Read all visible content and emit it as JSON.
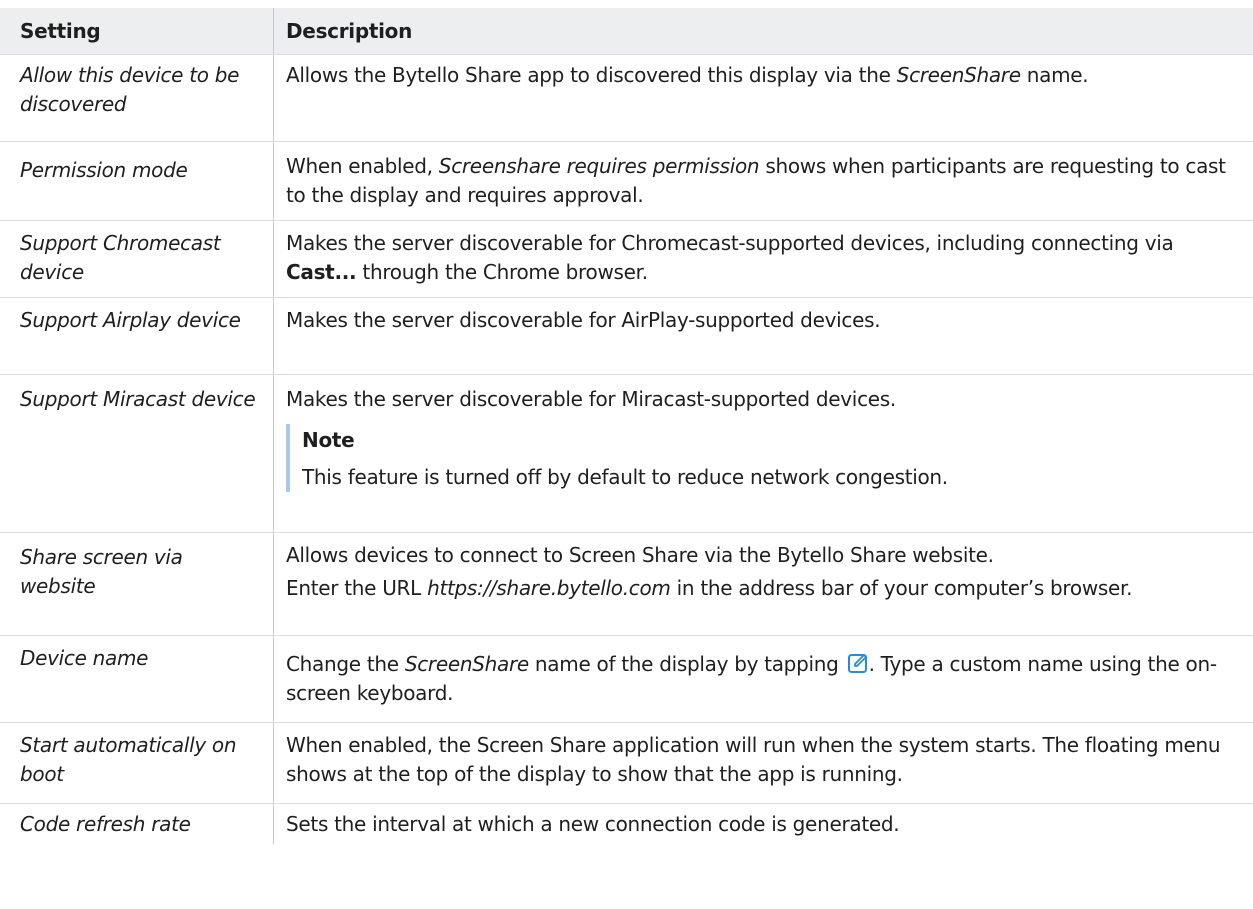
{
  "header": {
    "setting": "Setting",
    "description": "Description"
  },
  "rows": [
    {
      "setting": "Allow this device to be discovered",
      "desc": {
        "t1": "Allows the Bytello Share app to discovered this display via the ",
        "i1": "ScreenShare",
        "t2": " name."
      }
    },
    {
      "setting": "Permission mode",
      "desc": {
        "t1": "When enabled, ",
        "i1": "Screenshare requires permission",
        "t2": " shows when participants are requesting to cast to the display and requires approval."
      }
    },
    {
      "setting": "Support Chromecast device",
      "desc": {
        "t1": "Makes the server discoverable for Chromecast-supported devices, including connecting via ",
        "b1": "Cast...",
        "t2": " through the Chrome browser."
      }
    },
    {
      "setting": "Support Airplay device",
      "desc": {
        "t1": "Makes the server discoverable for AirPlay-supported devices."
      }
    },
    {
      "setting": "Support Miracast device",
      "desc": {
        "t1": "Makes the server discoverable for Miracast-supported devices.",
        "note_title": "Note",
        "note_text": "This feature is turned off by default to reduce network congestion."
      }
    },
    {
      "setting": "Share screen via website",
      "desc": {
        "t1": "Allows devices to connect to Screen Share via the Bytello Share website.",
        "t2": "Enter the URL ",
        "i1": "https://share.bytello.com",
        "t3": " in the address bar of your computer’s browser."
      }
    },
    {
      "setting": "Device name",
      "desc": {
        "t1": "Change the ",
        "i1": "ScreenShare",
        "t2": " name of the display by tapping ",
        "icon": "edit-icon",
        "t3": ". Type a custom name using the on-screen keyboard."
      }
    },
    {
      "setting": "Start automatically on boot",
      "desc": {
        "t1": "When enabled, the Screen Share application will run when the system starts. The floating menu shows at the top of the display to show that the app is running."
      }
    },
    {
      "setting": "Code refresh rate",
      "desc": {
        "t1": "Sets the interval at which a new connection code is generated."
      }
    }
  ],
  "colors": {
    "header_bg": "#eceef0",
    "note_bar": "#a9c9e4",
    "icon": "#2a8ad6"
  }
}
